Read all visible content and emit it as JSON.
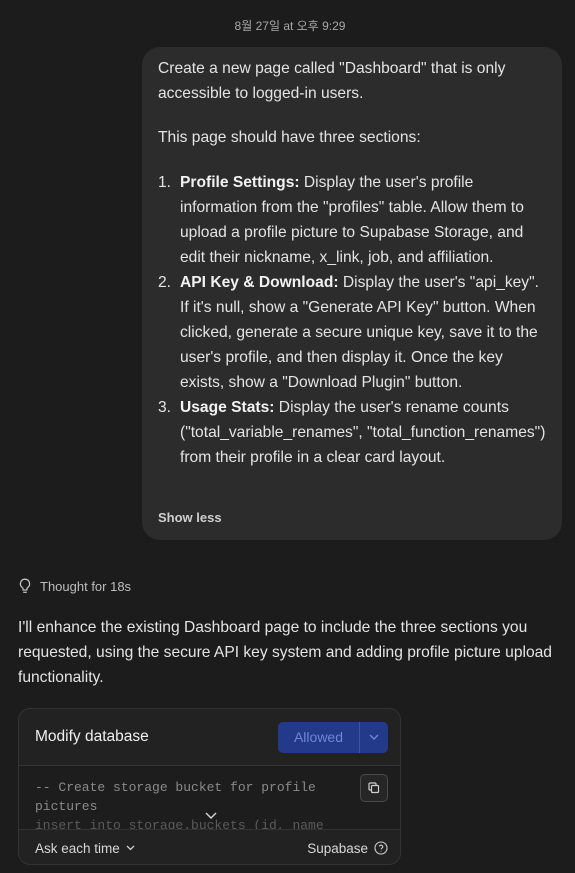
{
  "timestamp": "8월 27일 at 오후 9:29",
  "user_message": {
    "intro": "Create a new page called \"Dashboard\" that is only accessible to logged-in users.",
    "sections_intro": "This page should have three sections:",
    "items": [
      {
        "num": "1.",
        "title": "Profile Settings:",
        "text": " Display the user's profile information from the \"profiles\" table. Allow them to upload a profile picture to Supabase Storage, and edit their nickname, x_link, job, and affiliation."
      },
      {
        "num": "2.",
        "title": "API Key & Download:",
        "text": " Display the user's \"api_key\". If it's null, show a \"Generate API Key\" button. When clicked, generate a secure unique key, save it to the user's profile, and then display it. Once the key exists, show a \"Download Plugin\" button."
      },
      {
        "num": "3.",
        "title": "Usage Stats:",
        "text": " Display the user's rename counts (\"total_variable_renames\", \"total_function_renames\") from their profile in a clear card layout."
      }
    ],
    "show_less": "Show less"
  },
  "thought": {
    "icon": "lightbulb-icon",
    "label": "Thought for 18s"
  },
  "assistant_reply": "I'll enhance the existing Dashboard page to include the three sections you requested, using the secure API key system and adding profile picture upload functionality.",
  "tool_card": {
    "title": "Modify database",
    "allowed_label": "Allowed",
    "code_line1": "-- Create storage bucket for profile pictures",
    "code_line2": "insert into storage.buckets (id, name",
    "ask_label": "Ask each time",
    "provider_label": "Supabase"
  },
  "colors": {
    "background": "#1c1c1c",
    "bubble": "#2c2c2c",
    "allowed_button": "#23398a"
  }
}
